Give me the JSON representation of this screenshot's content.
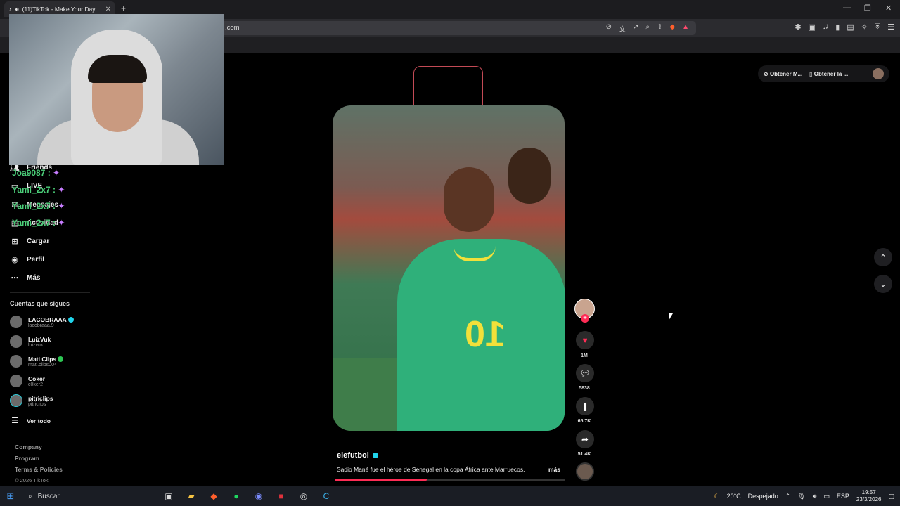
{
  "browser": {
    "tab_title": "(11)TikTok - Make Your Day",
    "url": ".com",
    "window_controls": [
      "—",
      "❐",
      "✕"
    ]
  },
  "chat": [
    {
      "user": "Joa9087 :",
      "emote": "✦"
    },
    {
      "user": "Yami_2x7 :",
      "emote": "✦"
    },
    {
      "user": "Yami_2x7 :",
      "emote": "✦"
    },
    {
      "user": "Yami_2x7 :",
      "emote": "✦"
    }
  ],
  "sidebar": {
    "items": [
      {
        "label": "Friends",
        "icon": "friends-icon"
      },
      {
        "label": "LIVE",
        "icon": "live-icon"
      },
      {
        "label": "Mensajes",
        "icon": "messages-icon"
      },
      {
        "label": "Actividad",
        "icon": "activity-icon"
      },
      {
        "label": "Cargar",
        "icon": "upload-icon"
      },
      {
        "label": "Perfil",
        "icon": "profile-icon"
      },
      {
        "label": "Más",
        "icon": "more-icon"
      }
    ],
    "following_title": "Cuentas que sigues",
    "following": [
      {
        "name": "LACOBRAAA",
        "handle": "lacobraaa.9",
        "badge": "verified"
      },
      {
        "name": "LuizVuk",
        "handle": "luizvuk",
        "badge": ""
      },
      {
        "name": "Mati Clips",
        "handle": "mati.clips004",
        "badge": "online"
      },
      {
        "name": "Coker",
        "handle": "c0ker2",
        "badge": ""
      },
      {
        "name": "pitriclips",
        "handle": "pitriclips",
        "badge": ""
      }
    ],
    "see_all": "Ver todo",
    "footer": {
      "company": "Company",
      "program": "Program",
      "terms": "Terms & Policies",
      "copyright": "© 2026 TikTok"
    }
  },
  "top_right": {
    "get_coins": "Obtener M...",
    "get_app": "Obtener la ..."
  },
  "video": {
    "jersey_number": "10",
    "author": "elefutbol",
    "caption": "Sadio Mané fue el héroe de Senegal en la copa África ante Marruecos.",
    "more_label": "más",
    "progress": 0.4
  },
  "actions": {
    "likes": "1M",
    "comments": "5838",
    "saves": "65.7K",
    "shares": "51.4K"
  },
  "taskbar": {
    "search_label": "Buscar",
    "weather_temp": "20°C",
    "weather_text": "Despejado",
    "language": "ESP",
    "time": "19:57",
    "date": "23/3/2026"
  }
}
